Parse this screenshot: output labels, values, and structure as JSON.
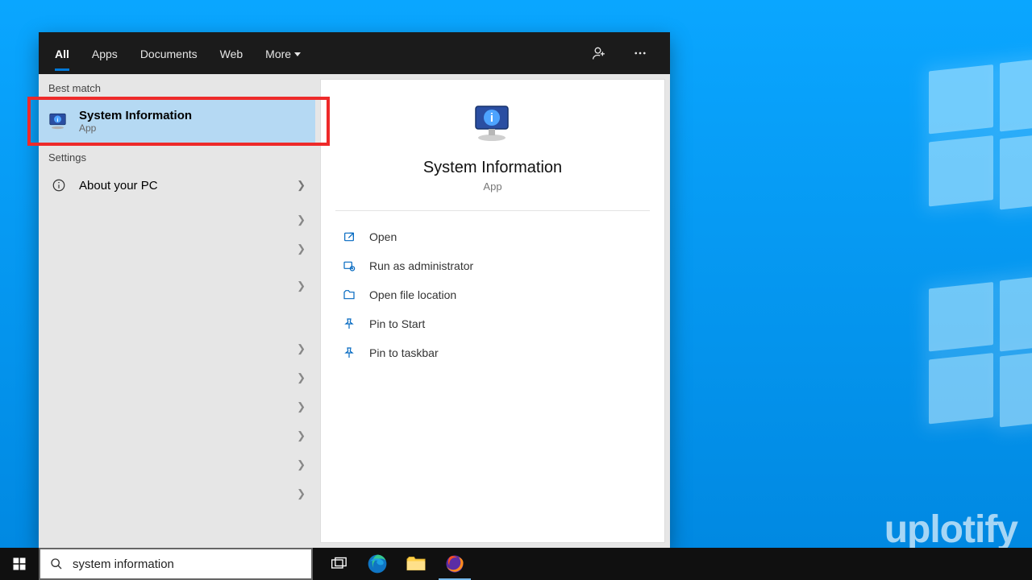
{
  "tabs": {
    "all": "All",
    "apps": "Apps",
    "documents": "Documents",
    "web": "Web",
    "more": "More"
  },
  "sections": {
    "best_match": "Best match",
    "settings": "Settings"
  },
  "best_match_item": {
    "title": "System Information",
    "subtitle": "App"
  },
  "settings_item": {
    "title": "About your PC"
  },
  "preview": {
    "title": "System Information",
    "subtitle": "App"
  },
  "actions": {
    "open": "Open",
    "run_admin": "Run as administrator",
    "open_loc": "Open file location",
    "pin_start": "Pin to Start",
    "pin_taskbar": "Pin to taskbar"
  },
  "search": {
    "value": "system information"
  },
  "watermark": "uplotify"
}
